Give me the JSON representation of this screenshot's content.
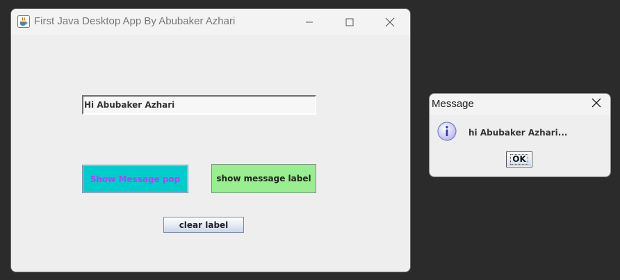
{
  "main_window": {
    "title": "First Java Desktop App By Abubaker Azhari",
    "text_field_value": "Hi Abubaker Azhari",
    "buttons": {
      "show_message_pop": "Show Message pop",
      "show_message_label": "show message label",
      "clear_label": "clear label"
    },
    "colors": {
      "show_message_pop_bg": "#00CCCC",
      "show_message_pop_text": "#CC33FF",
      "show_message_label_bg": "#99EE8F"
    },
    "icons": {
      "app": "java-icon",
      "minimize": "minimize-icon",
      "maximize": "maximize-icon",
      "close": "close-icon"
    }
  },
  "dialog": {
    "title": "Message",
    "message": "hi Abubaker Azhari...",
    "ok_label": "OK",
    "icons": {
      "info": "info-icon",
      "close": "close-icon"
    }
  }
}
